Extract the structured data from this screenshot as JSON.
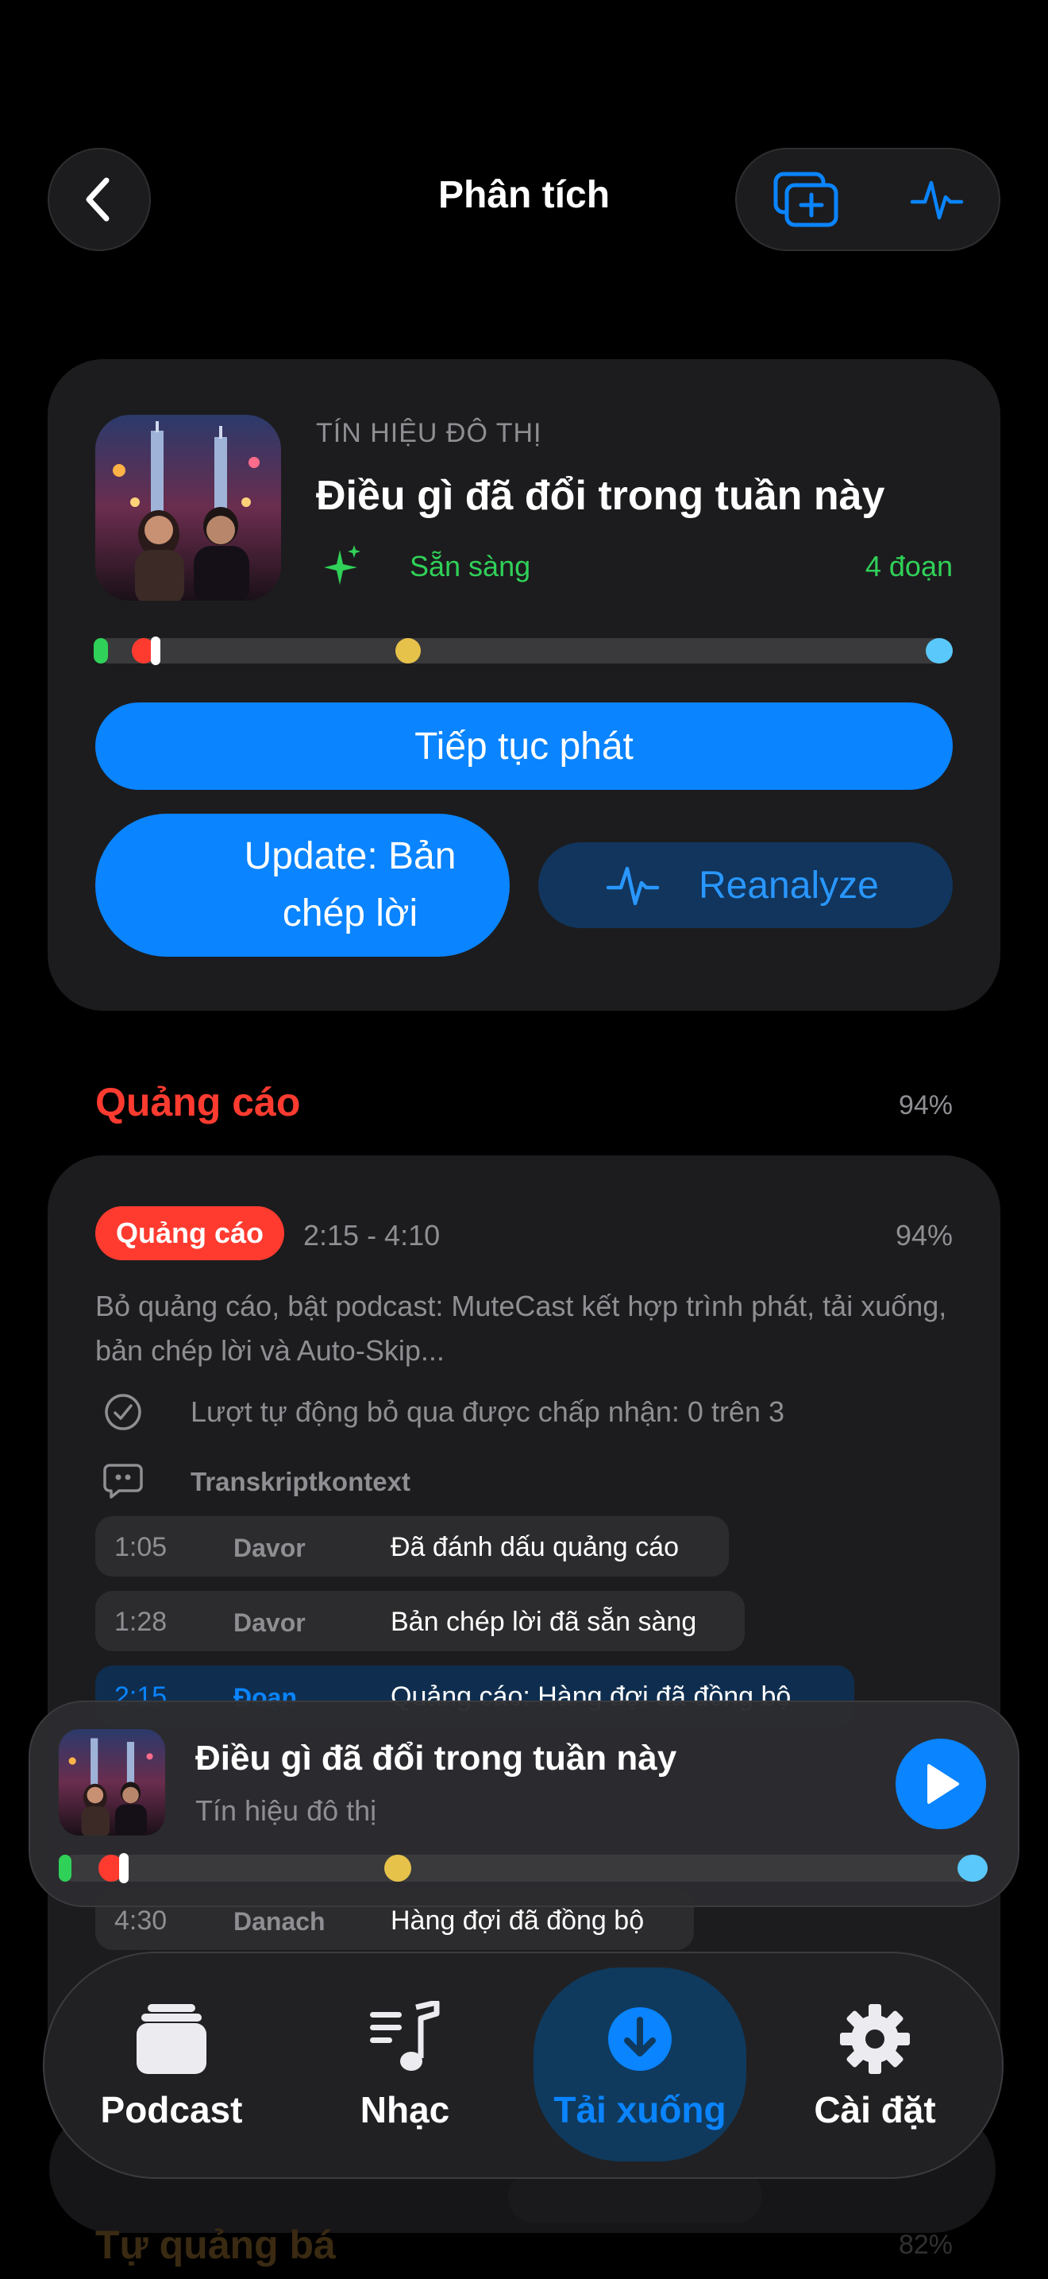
{
  "header": {
    "title": "Phân tích",
    "back_icon": "chevron-left-icon",
    "actions": [
      "add-to-library-icon",
      "waveform-icon"
    ]
  },
  "episode": {
    "show": "TÍN HIỆU ĐÔ THỊ",
    "title": "Điều gì đã đổi trong tuần này",
    "status": "Sẵn sàng",
    "segments": "4 đoạn",
    "playback_progress": 0.07,
    "continue_label": "Tiếp tục phát",
    "update_label": "Update: Bản chép lời",
    "reanalyze_label": "Reanalyze"
  },
  "section": {
    "title": "Quảng cáo",
    "percent": "94%"
  },
  "ad_segment": {
    "badge": "Quảng cáo",
    "time_range": "2:15 - 4:10",
    "percent": "94%",
    "description": "Bỏ quảng cáo, bật podcast: MuteCast kết hợp trình phát, tải xuống, bản chép lời và Auto-Skip...",
    "auto_skip": "Lượt tự động bỏ qua được chấp nhận: 0 trên 3",
    "context_label": "Transkriptkontext",
    "transcript": [
      {
        "time": "1:05",
        "speaker": "Davor",
        "text": "Đã đánh dấu quảng cáo"
      },
      {
        "time": "1:28",
        "speaker": "Davor",
        "text": "Bản chép lời đã sẵn sàng"
      },
      {
        "time": "2:15",
        "speaker": "Đoạn",
        "text": "Quảng cáo: Hàng đợi đã đồng bộ"
      },
      {
        "time": "4:30",
        "speaker": "Danach",
        "text": "Hàng đợi đã đồng bộ"
      }
    ]
  },
  "mini_player": {
    "title": "Điều gì đã đổi trong tuần này",
    "subtitle": "Tín hiệu đô thị",
    "progress": 0.07
  },
  "peek_section": {
    "title": "Tự quảng bá",
    "percent": "82%"
  },
  "tabs": [
    {
      "label": "Podcast",
      "icon": "podcast-stack-icon"
    },
    {
      "label": "Nhạc",
      "icon": "music-note-icon"
    },
    {
      "label": "Tải xuống",
      "icon": "download-icon",
      "active": true
    },
    {
      "label": "Cài đặt",
      "icon": "gear-icon"
    }
  ],
  "colors": {
    "accent": "#0a84ff",
    "ad_red": "#ff3b30",
    "ready_green": "#30d158",
    "marker_yellow": "#e6c24a",
    "marker_cyan": "#5ac8fa"
  }
}
